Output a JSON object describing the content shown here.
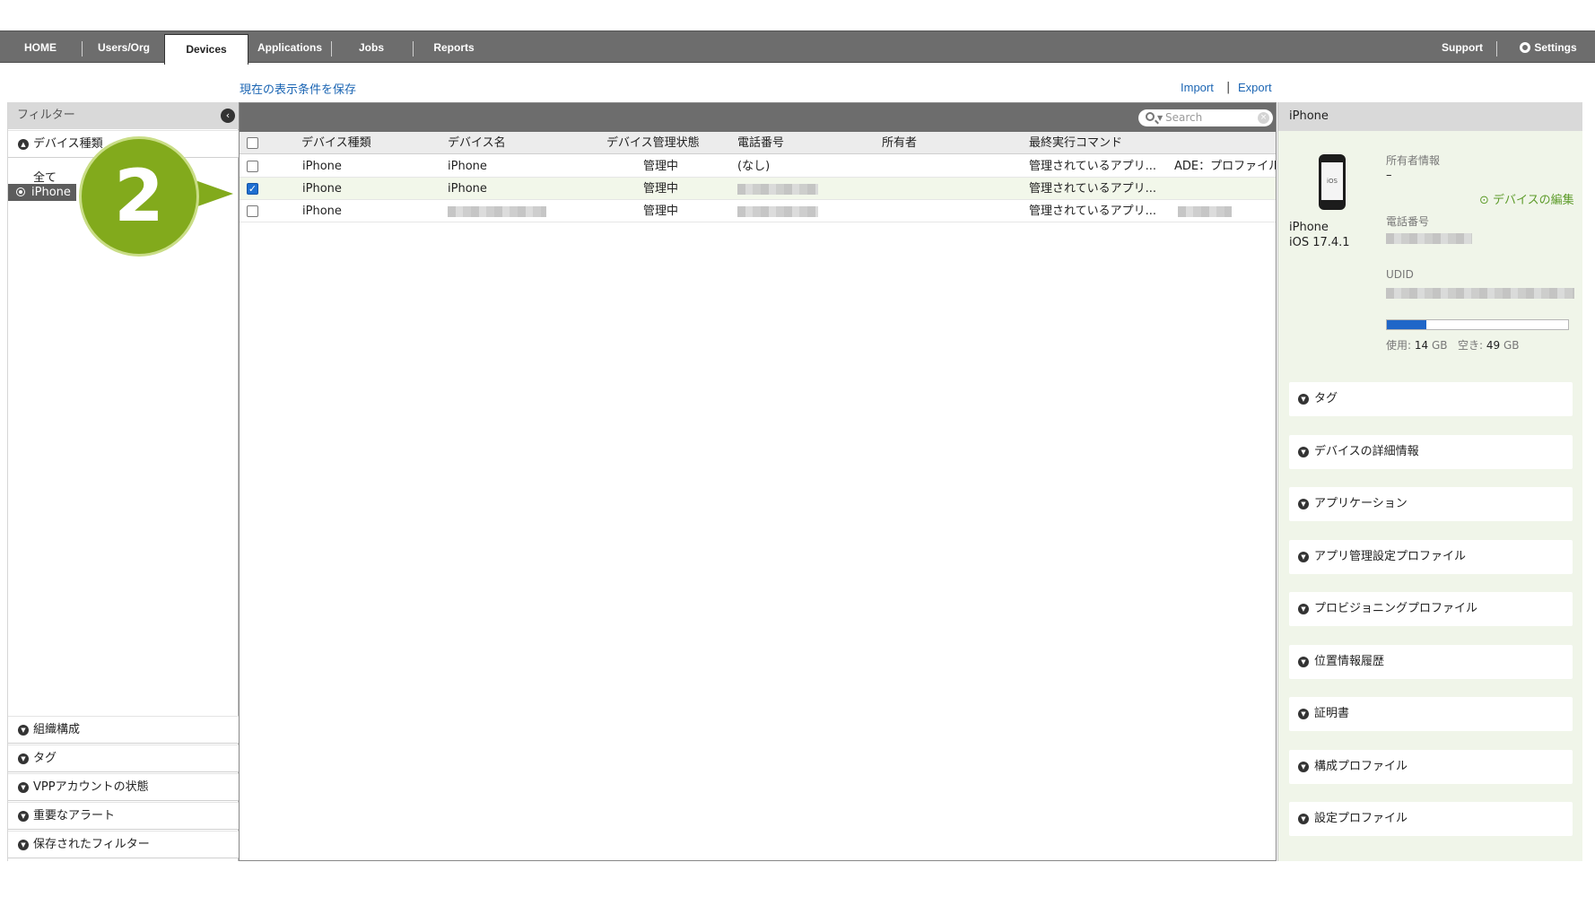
{
  "nav": {
    "tabs": [
      "HOME",
      "Users/Org",
      "Devices",
      "Applications",
      "Jobs",
      "Reports"
    ],
    "active_tab": "Devices",
    "right": [
      "Support",
      "Settings"
    ]
  },
  "toolbar": {
    "save_view": "現在の表示条件を保存",
    "import": "Import",
    "sep": "|",
    "export": "Export"
  },
  "filter": {
    "title": "フィルター",
    "device_type_section": "デバイス種類",
    "items": [
      "全て",
      "iPhone"
    ],
    "selected_item": "iPhone",
    "sections": [
      "組織構成",
      "タグ",
      "VPPアカウントの状態",
      "重要なアラート",
      "保存されたフィルター"
    ]
  },
  "grid": {
    "search_placeholder": "Search",
    "columns": [
      "デバイス種類",
      "デバイス名",
      "デバイス管理状態",
      "電話番号",
      "所有者",
      "最終実行コマンド"
    ],
    "rows": [
      {
        "checked": false,
        "type": "iPhone",
        "name": "iPhone",
        "status": "管理中",
        "phone": "(なし)",
        "owner": "",
        "command": "管理されているアプリ...",
        "extra": "ADE：プロファイル"
      },
      {
        "checked": true,
        "type": "iPhone",
        "name": "iPhone",
        "status": "管理中",
        "phone": "",
        "owner": "",
        "command": "管理されているアプリ...",
        "extra": ""
      },
      {
        "checked": false,
        "type": "iPhone",
        "name": "",
        "status": "管理中",
        "phone": "",
        "owner": "",
        "command": "管理されているアプリ...",
        "extra": ""
      }
    ]
  },
  "detail": {
    "title": "iPhone",
    "device_model": "iPhone",
    "os_version": "iOS 17.4.1",
    "phone_screen": "iOS",
    "owner_info_label": "所有者情報",
    "owner_info_value": "–",
    "edit_link": "デバイスの編集",
    "phone_label": "電話番号",
    "udid_label": "UDID",
    "storage": {
      "used_label": "使用:",
      "used_value": "14",
      "used_unit": "GB",
      "free_label": "空き:",
      "free_value": "49",
      "free_unit": "GB",
      "used_fraction": 0.22
    },
    "accordions": [
      "タグ",
      "デバイスの詳細情報",
      "アプリケーション",
      "アプリ管理設定プロファイル",
      "プロビジョニングプロファイル",
      "位置情報履歴",
      "証明書",
      "構成プロファイル",
      "設定プロファイル"
    ]
  },
  "marker": {
    "number": "2",
    "color": "#82aa1c"
  },
  "colors": {
    "nav_bg": "#6d6d6d",
    "link": "#1b65b3",
    "edit_link": "#5d9b2a",
    "checkbox_on": "#1f6fd1",
    "storage_fill": "#1f66c8",
    "detail_bg": "#f0f5e9"
  }
}
